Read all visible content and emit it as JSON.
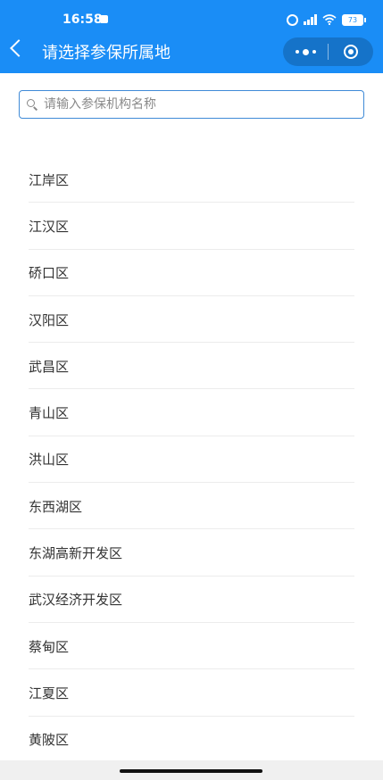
{
  "status_bar": {
    "time": "16:58",
    "battery": "73"
  },
  "header": {
    "title": "请选择参保所属地"
  },
  "search": {
    "placeholder": "请输入参保机构名称",
    "value": ""
  },
  "districts": [
    "江岸区",
    "江汉区",
    "硚口区",
    "汉阳区",
    "武昌区",
    "青山区",
    "洪山区",
    "东西湖区",
    "东湖高新开发区",
    "武汉经济开发区",
    "蔡甸区",
    "江夏区",
    "黄陂区"
  ],
  "colors": {
    "header_bg": "#1a8df6",
    "search_border": "#3f8ad7",
    "text": "#333333"
  }
}
